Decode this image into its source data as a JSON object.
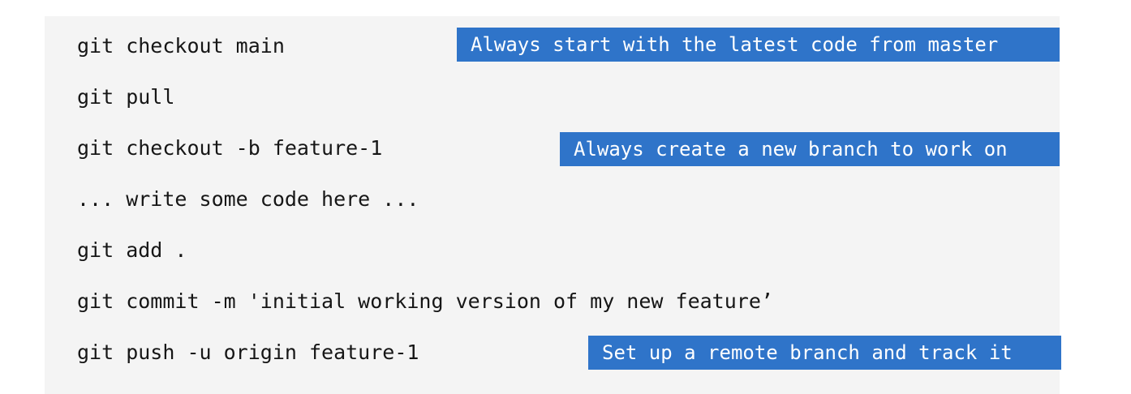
{
  "code_lines": [
    "git checkout main",
    "git pull",
    "git checkout -b feature-1",
    "... write some code here ...",
    "git add .",
    "git commit -m 'initial working version of my new feature’",
    "git push -u origin feature-1"
  ],
  "callouts": [
    "Always start with the latest code from master",
    "Always create a new branch to work on",
    "Set up a remote branch and track it"
  ],
  "colors": {
    "panel_background": "#f4f4f4",
    "callout_background": "#2f74c9",
    "callout_text": "#ffffff",
    "code_text": "#161616"
  }
}
